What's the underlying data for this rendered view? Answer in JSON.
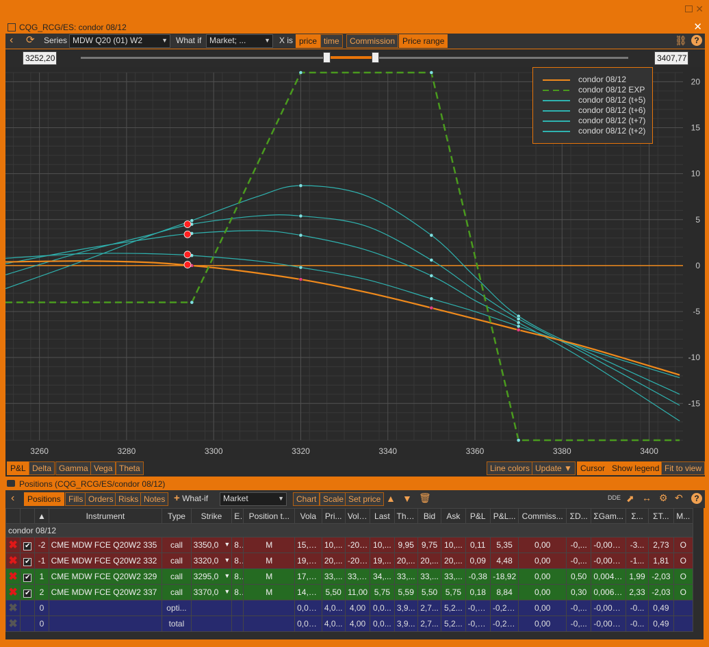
{
  "window": {
    "title": "CQG_RCG/ES: condor 08/12"
  },
  "toolbar": {
    "series_label": "Series",
    "series_value": "MDW Q20 (01) W2",
    "whatif_label": "What if",
    "whatif_value": "Market; ...",
    "xis_label": "X is",
    "price": "price",
    "time": "time",
    "commission": "Commission",
    "price_range": "Price range"
  },
  "slider": {
    "min_value": "3252,20",
    "max_value": "3407,77"
  },
  "legend": [
    {
      "label": "condor 08/12",
      "color": "#f08a1c",
      "style": "solid"
    },
    {
      "label": "condor 08/12 EXP",
      "color": "#4a9a1e",
      "style": "dashed"
    },
    {
      "label": "condor 08/12 (t+5)",
      "color": "#2fb3b0",
      "style": "solid"
    },
    {
      "label": "condor 08/12 (t+6)",
      "color": "#2fb3b0",
      "style": "solid"
    },
    {
      "label": "condor 08/12 (t+7)",
      "color": "#2fb3b0",
      "style": "solid"
    },
    {
      "label": "condor 08/12 (t+2)",
      "color": "#2fb3b0",
      "style": "solid"
    }
  ],
  "chart_data": {
    "type": "line",
    "xlim": [
      3252.2,
      3407.77
    ],
    "ylim": [
      -19,
      21
    ],
    "x_ticks": [
      3260,
      3280,
      3300,
      3320,
      3340,
      3360,
      3380,
      3400
    ],
    "y_ticks": [
      20,
      15,
      10,
      5,
      0,
      -5,
      -10,
      -15
    ],
    "grid": true,
    "legend_position": "top-right",
    "series": [
      {
        "name": "condor 08/12",
        "color": "#f08a1c",
        "dash": false,
        "width": 2.2,
        "x": [
          3252.2,
          3270,
          3285,
          3295,
          3305,
          3320,
          3335,
          3350,
          3365,
          3370,
          3385,
          3407
        ],
        "y": [
          0.4,
          0.5,
          0.35,
          0.0,
          -0.5,
          -1.5,
          -2.9,
          -4.6,
          -6.4,
          -7.0,
          -8.8,
          -11.9
        ]
      },
      {
        "name": "condor 08/12 EXP",
        "color": "#4a9a1e",
        "dash": true,
        "width": 2.5,
        "x": [
          3252.2,
          3295,
          3320,
          3350,
          3370,
          3407
        ],
        "y": [
          -4,
          -4,
          21,
          21,
          -19,
          -19
        ]
      },
      {
        "name": "condor 08/12 (t+5)",
        "color": "#2fb3b0",
        "dash": false,
        "width": 1.2,
        "x": [
          3252.2,
          3270,
          3285,
          3295,
          3310,
          3320,
          3335,
          3350,
          3360,
          3370,
          3385,
          3407
        ],
        "y": [
          -2.5,
          0.5,
          3.2,
          4.9,
          7.5,
          8.7,
          7.6,
          3.3,
          -1.2,
          -5.5,
          -9.2,
          -14.0
        ]
      },
      {
        "name": "condor 08/12 (t+6)",
        "color": "#2fb3b0",
        "dash": false,
        "width": 1.2,
        "x": [
          3252.2,
          3270,
          3285,
          3295,
          3310,
          3320,
          3335,
          3350,
          3360,
          3370,
          3385,
          3407
        ],
        "y": [
          -1.0,
          1.5,
          3.3,
          4.5,
          5.4,
          5.4,
          4.3,
          0.6,
          -2.7,
          -5.8,
          -9.5,
          -15.2
        ]
      },
      {
        "name": "condor 08/12 (t+7)",
        "color": "#2fb3b0",
        "dash": false,
        "width": 1.2,
        "x": [
          3252.2,
          3270,
          3285,
          3295,
          3310,
          3320,
          3335,
          3350,
          3360,
          3370,
          3385,
          3407
        ],
        "y": [
          0.2,
          1.8,
          2.9,
          3.5,
          3.8,
          3.3,
          1.7,
          -1.1,
          -3.8,
          -6.2,
          -10.2,
          -16.9
        ]
      },
      {
        "name": "condor 08/12 (t+2)",
        "color": "#2fb3b0",
        "dash": false,
        "width": 1.2,
        "x": [
          3252.2,
          3270,
          3285,
          3295,
          3310,
          3320,
          3335,
          3350,
          3360,
          3370,
          3385,
          3407
        ],
        "y": [
          0.8,
          1.3,
          1.3,
          1.1,
          0.5,
          -0.2,
          -1.5,
          -3.6,
          -5.0,
          -6.6,
          -9.0,
          -12.2
        ]
      }
    ],
    "horizontal_line": {
      "y": 0,
      "color": "#f08a1c"
    },
    "markers": [
      {
        "x": 3294,
        "y": 4.5,
        "color": "#ff2020"
      },
      {
        "x": 3294,
        "y": 3.4,
        "color": "#ff2020"
      },
      {
        "x": 3294,
        "y": 1.2,
        "color": "#ff2020"
      },
      {
        "x": 3294,
        "y": 0.1,
        "color": "#ff2020"
      }
    ]
  },
  "chart_tabs": [
    "P&L",
    "Delta",
    "Gamma",
    "Vega",
    "Theta"
  ],
  "chart_buttons": {
    "line_colors": "Line colors",
    "update": "Update",
    "cursor": "Cursor",
    "show_legend": "Show legend",
    "fit_to_view": "Fit to view"
  },
  "positions": {
    "title": "Positions (CQG_RCG/ES/condor 08/12)",
    "tabs": [
      "Positions",
      "Fills",
      "Orders",
      "Risks",
      "Notes"
    ],
    "whatif_label": "What-if",
    "whatif_value": "Market",
    "chart_btn": "Chart",
    "scale_btn": "Scale",
    "setprice_btn": "Set price",
    "dde_label": "DDE",
    "columns": [
      "Instrument",
      "Type",
      "Strike",
      "E.",
      "Position t...",
      "Vola",
      "Pri...",
      "Volu...",
      "Last",
      "Theo",
      "Bid",
      "Ask",
      "P&L",
      "P&L...",
      "Commiss...",
      "ΣD...",
      "ΣGam...",
      "Σ...",
      "ΣT...",
      "M..."
    ],
    "group": "condor 08/12",
    "rows": [
      {
        "style": "red",
        "qty": "-2",
        "cells": [
          "CME MDW FCE Q20W2 335",
          "call",
          "3350,0",
          "8...",
          "M",
          "15,0...",
          "10,...",
          "-20,00",
          "10,...",
          "9,95",
          "9,75",
          "10,...",
          "0,11",
          "5,35",
          "0,00",
          "-0,...",
          "-0,008...",
          "-3...",
          "2,73",
          "O"
        ]
      },
      {
        "style": "red",
        "qty": "-1",
        "cells": [
          "CME MDW FCE Q20W2 332",
          "call",
          "3320,0",
          "8...",
          "M",
          "19,0...",
          "20,...",
          "-20,50",
          "19,...",
          "20,...",
          "20,...",
          "20,...",
          "0,09",
          "4,48",
          "0,00",
          "-0,...",
          "-0,004...",
          "-1...",
          "1,81",
          "O"
        ]
      },
      {
        "style": "green",
        "qty": "1",
        "cells": [
          "CME MDW FCE Q20W2 329",
          "call",
          "3295,0",
          "8...",
          "M",
          "17,0...",
          "33,...",
          "33,50",
          "34,...",
          "33,...",
          "33,...",
          "33,...",
          "-0,38",
          "-18,92",
          "0,00",
          "0,50",
          "0,0047...",
          "1,99",
          "-2,03",
          "O"
        ]
      },
      {
        "style": "green",
        "qty": "2",
        "cells": [
          "CME MDW FCE Q20W2 337",
          "call",
          "3370,0",
          "8...",
          "M",
          "14,5...",
          "5,50",
          "11,00",
          "5,75",
          "5,59",
          "5,50",
          "5,75",
          "0,18",
          "8,84",
          "0,00",
          "0,30",
          "0,0064...",
          "2,33",
          "-2,03",
          "O"
        ]
      },
      {
        "style": "blue",
        "qty": "0",
        "cells": [
          "",
          "opti...",
          "",
          "",
          "",
          "0,00...",
          "4,0...",
          "4,00",
          "0,0...",
          "3,9...",
          "2,7...",
          "5,2...",
          "-0,0...",
          "-0,24...",
          "0,00",
          "-0,...",
          "-0,001...",
          "-0...",
          "0,49",
          ""
        ]
      },
      {
        "style": "blue",
        "qty": "0",
        "cells": [
          "",
          "total",
          "",
          "",
          "",
          "0,00...",
          "4,0...",
          "4,00",
          "0,0...",
          "3,9...",
          "2,7...",
          "5,2...",
          "-0,0...",
          "-0,24...",
          "0,00",
          "-0,...",
          "-0,001...",
          "-0...",
          "0,49",
          ""
        ]
      }
    ]
  }
}
